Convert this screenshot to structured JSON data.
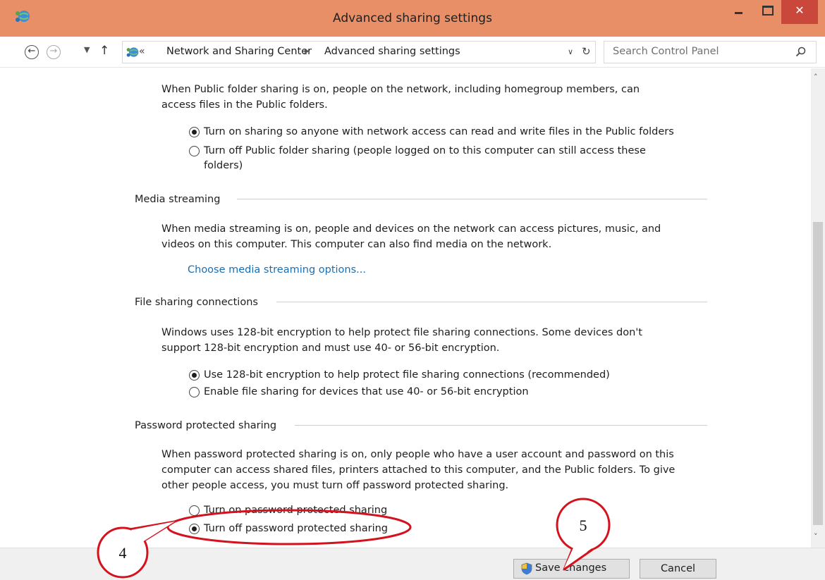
{
  "window": {
    "title": "Advanced sharing settings",
    "close_glyph": "✕",
    "icon": "network-sharing-icon",
    "colors": {
      "titlebar": "#e88f67",
      "close": "#c9483b"
    }
  },
  "navigation": {
    "back_glyph": "←",
    "forward_glyph": "→",
    "recent_glyph": "▼",
    "up_glyph": "↑",
    "breadcrumb": {
      "overflow": "«",
      "items": [
        "Network and Sharing Center",
        "Advanced sharing settings"
      ],
      "separator": "▶"
    },
    "dropdown_glyph": "∨",
    "refresh_glyph": "↻",
    "search_placeholder": "Search Control Panel"
  },
  "public_folder": {
    "description_line1": "When Public folder sharing is on, people on the network, including homegroup members, can",
    "description_line2": "access files in the Public folders.",
    "options": [
      {
        "label": "Turn on sharing so anyone with network access can read and write files in the Public folders",
        "checked": true
      },
      {
        "label": "Turn off Public folder sharing (people logged on to this computer can still access these",
        "label_cont": "folders)",
        "checked": false
      }
    ]
  },
  "media_streaming": {
    "heading": "Media streaming",
    "description_line1": "When media streaming is on, people and devices on the network can access pictures, music, and",
    "description_line2": "videos on this computer. This computer can also find media on the network.",
    "link": "Choose media streaming options..."
  },
  "file_sharing": {
    "heading": "File sharing connections",
    "description_line1": "Windows uses 128-bit encryption to help protect file sharing connections. Some devices don't",
    "description_line2": "support 128-bit encryption and must use 40- or 56-bit encryption.",
    "options": [
      {
        "label": "Use 128-bit encryption to help protect file sharing connections (recommended)",
        "checked": true
      },
      {
        "label": "Enable file sharing for devices that use 40- or 56-bit encryption",
        "checked": false
      }
    ]
  },
  "password_sharing": {
    "heading": "Password protected sharing",
    "description_line1": "When password protected sharing is on, only people who have a user account and password on this",
    "description_line2": "computer can access shared files, printers attached to this computer, and the Public folders. To give",
    "description_line3": "other people access, you must turn off password protected sharing.",
    "options": [
      {
        "label": "Turn on password protected sharing",
        "checked": false
      },
      {
        "label": "Turn off password protected sharing",
        "checked": true
      }
    ]
  },
  "scrollbar": {
    "up_glyph": "˄",
    "down_glyph": "˅"
  },
  "footer": {
    "save_label": "Save changes",
    "cancel_label": "Cancel"
  },
  "annotations": {
    "step4": "4",
    "step5": "5",
    "color": "#d4121e"
  }
}
